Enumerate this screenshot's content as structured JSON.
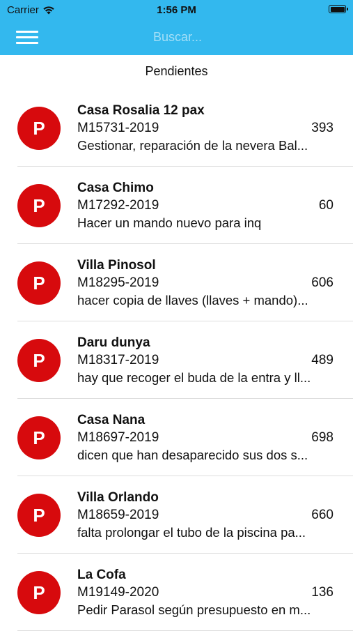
{
  "status_bar": {
    "carrier": "Carrier",
    "time": "1:56 PM",
    "icons": [
      "wifi-icon",
      "battery-icon"
    ]
  },
  "nav": {
    "menu_icon": "hamburger-menu-icon",
    "search_placeholder": "Buscar..."
  },
  "section_title": "Pendientes",
  "colors": {
    "header_bg": "#33b8ee",
    "avatar_bg": "#d70a0d",
    "divider": "#dddddd"
  },
  "items": [
    {
      "avatar": "P",
      "title": "Casa Rosalia 12 pax",
      "code": "M15731-2019",
      "count": "393",
      "description": "Gestionar, reparación de la nevera Bal..."
    },
    {
      "avatar": "P",
      "title": "Casa Chimo",
      "code": "M17292-2019",
      "count": "60",
      "description": "Hacer un mando nuevo para inq"
    },
    {
      "avatar": "P",
      "title": "Villa Pinosol",
      "code": "M18295-2019",
      "count": "606",
      "description": "hacer copia de llaves (llaves + mando)..."
    },
    {
      "avatar": "P",
      "title": "Daru dunya",
      "code": "M18317-2019",
      "count": "489",
      "description": "hay que recoger el buda de la entra y ll..."
    },
    {
      "avatar": "P",
      "title": "Casa Nana",
      "code": "M18697-2019",
      "count": "698",
      "description": "dicen que han desaparecido sus dos s..."
    },
    {
      "avatar": "P",
      "title": "Villa Orlando",
      "code": "M18659-2019",
      "count": "660",
      "description": "falta prolongar el tubo de la piscina pa..."
    },
    {
      "avatar": "P",
      "title": "La Cofa",
      "code": "M19149-2020",
      "count": "136",
      "description": "Pedir Parasol según presupuesto en m..."
    }
  ]
}
